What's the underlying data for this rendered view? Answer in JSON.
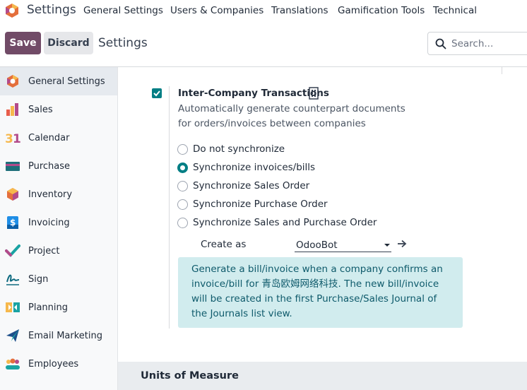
{
  "navbar": {
    "app_title": "Settings",
    "menu": [
      "General Settings",
      "Users & Companies",
      "Translations",
      "Gamification Tools",
      "Technical"
    ]
  },
  "control_panel": {
    "save_label": "Save",
    "discard_label": "Discard",
    "breadcrumb": "Settings",
    "search_placeholder": "Search..."
  },
  "sidebar": {
    "items": [
      {
        "label": "General Settings",
        "icon": "general-settings-icon",
        "active": true
      },
      {
        "label": "Sales",
        "icon": "sales-icon"
      },
      {
        "label": "Calendar",
        "icon": "calendar-icon"
      },
      {
        "label": "Purchase",
        "icon": "purchase-icon"
      },
      {
        "label": "Inventory",
        "icon": "inventory-icon"
      },
      {
        "label": "Invoicing",
        "icon": "invoicing-icon"
      },
      {
        "label": "Project",
        "icon": "project-icon"
      },
      {
        "label": "Sign",
        "icon": "sign-icon"
      },
      {
        "label": "Planning",
        "icon": "planning-icon"
      },
      {
        "label": "Email Marketing",
        "icon": "email-marketing-icon"
      },
      {
        "label": "Employees",
        "icon": "employees-icon"
      }
    ]
  },
  "setting": {
    "title": "Inter-Company Transactions",
    "description": "Automatically generate counterpart documents for orders/invoices between companies",
    "checked": true,
    "options": [
      {
        "label": "Do not synchronize",
        "checked": false
      },
      {
        "label": "Synchronize invoices/bills",
        "checked": true
      },
      {
        "label": "Synchronize Sales Order",
        "checked": false
      },
      {
        "label": "Synchronize Purchase Order",
        "checked": false
      },
      {
        "label": "Synchronize Sales and Purchase Order",
        "checked": false
      }
    ],
    "create_as_label": "Create as",
    "create_as_value": "OdooBot",
    "info_text": "Generate a bill/invoice when a company confirms an invoice/bill for 青岛欧姆网络科技. The new bill/invoice will be created in the first Purchase/Sales Journal of the Journals list view."
  },
  "next_section": {
    "title": "Units of Measure"
  },
  "colors": {
    "primary": "#714b67",
    "accent": "#017e84",
    "info_bg": "#d1ecee"
  }
}
